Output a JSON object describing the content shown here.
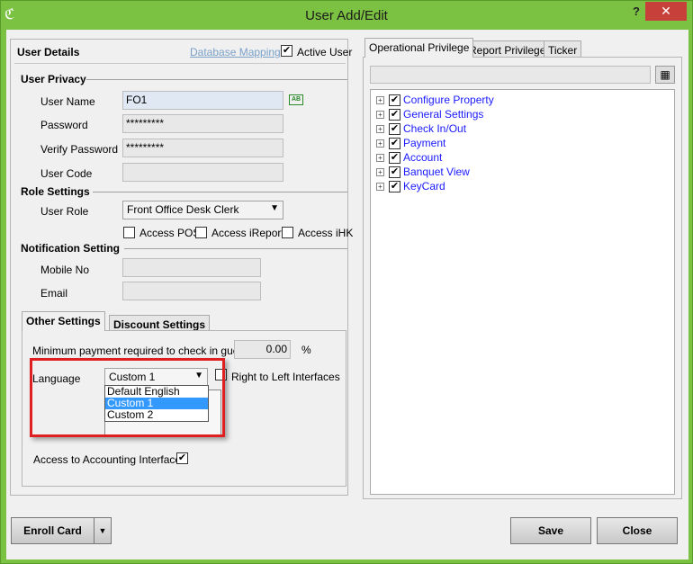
{
  "window": {
    "title": "User Add/Edit",
    "help": "?",
    "close": "✕",
    "app_icon": "ℭ"
  },
  "user_details": {
    "heading": "User Details",
    "db_mapping": "Database Mapping",
    "active_user_label": "Active User",
    "active_user_checked": "✔"
  },
  "privacy": {
    "heading": "User Privacy",
    "user_name_label": "User Name",
    "user_name_value": "FO1",
    "password_label": "Password",
    "password_value": "*********",
    "verify_label": "Verify Password",
    "verify_value": "*********",
    "user_code_label": "User Code",
    "user_code_value": "",
    "ab_badge": "AB"
  },
  "role": {
    "heading": "Role Settings",
    "user_role_label": "User Role",
    "user_role_value": "Front Office Desk Clerk",
    "access_pos": "Access POS",
    "access_ireport": "Access iReport",
    "access_ihk": "Access iHK"
  },
  "notification": {
    "heading": "Notification Setting",
    "mobile_label": "Mobile No",
    "email_label": "Email"
  },
  "other_tabs": [
    "Other Settings",
    "Discount Settings"
  ],
  "other": {
    "min_payment_label": "Minimum payment required to check in guest",
    "min_payment_value": "0.00",
    "percent": "%",
    "language_label": "Language",
    "language_value": "Custom 1",
    "rtl_label": "Right to Left Interfaces",
    "language_options": [
      "Default English",
      "Custom 1",
      "Custom 2"
    ],
    "accounting_label": "Access to Accounting Interface",
    "accounting_checked": "✔"
  },
  "privilege_tabs": [
    "Operational Privilege",
    "Report Privilege",
    "Ticker"
  ],
  "privilege_tree": [
    "Configure Property",
    "General Settings",
    "Check In/Out",
    "Payment",
    "Account",
    "Banquet View",
    "KeyCard"
  ],
  "buttons": {
    "enroll": "Enroll Card",
    "enroll_arrow": "▼",
    "save": "Save",
    "close": "Close"
  },
  "colors": {
    "frame": "#7cc242",
    "highlight": "#e02020",
    "selection": "#3399ff"
  }
}
